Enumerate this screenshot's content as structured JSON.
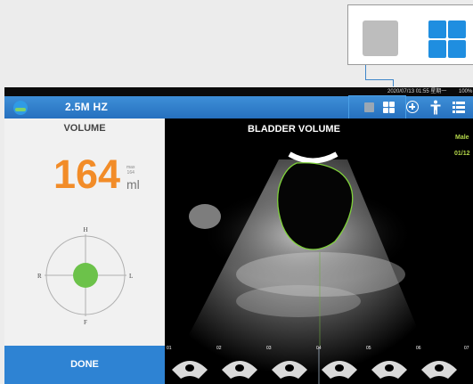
{
  "callout": {
    "single_view_icon": "single-view-icon",
    "quad_view_icon": "quad-view-icon"
  },
  "status_bar": {
    "datetime": "2020/07/13 01:55 星期一",
    "battery": "100%"
  },
  "header": {
    "logo_icon": "probe-logo-icon",
    "frequency": "2.5M HZ",
    "tools": [
      "single-view-icon",
      "quad-view-icon",
      "add-circle-icon",
      "person-icon",
      "list-menu-icon"
    ]
  },
  "volume_panel": {
    "title": "VOLUME",
    "value": "164",
    "max_label": "max",
    "max_value": "164",
    "unit": "ml",
    "compass": {
      "top": "H",
      "bottom": "F",
      "left": "R",
      "right": "L"
    },
    "done_label": "DONE"
  },
  "scan_view": {
    "title": "BLADDER VOLUME",
    "gender": "Male",
    "date": "01/12",
    "thumbnails": [
      "01",
      "02",
      "03",
      "04",
      "05",
      "06",
      "07"
    ]
  },
  "colors": {
    "accent": "#2e83d3",
    "volume": "#f28c28",
    "contour": "#7fd23a",
    "info_text": "#b5d84a"
  }
}
